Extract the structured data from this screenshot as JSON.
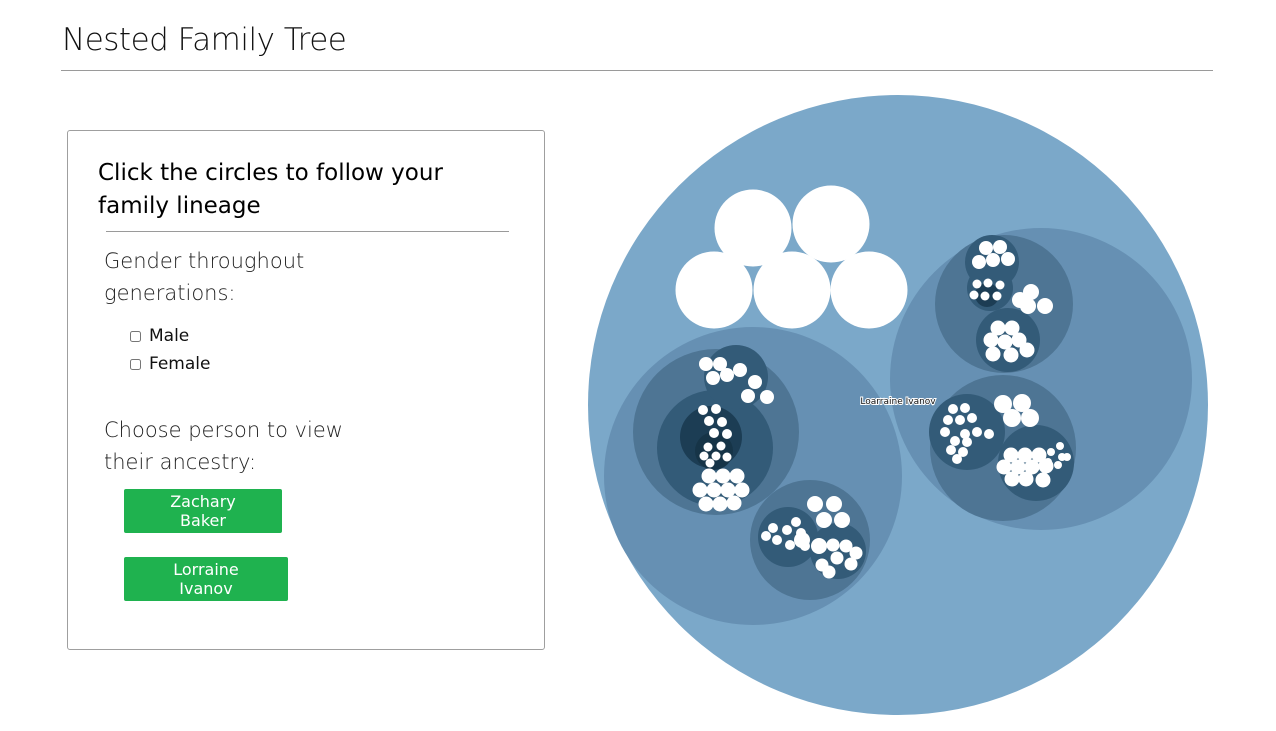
{
  "page": {
    "title": "Nested Family Tree"
  },
  "panel": {
    "heading": "Click the circles to follow your family lineage",
    "gender_label": "Gender throughout generations:",
    "gender_options": [
      {
        "label": "Male",
        "checked": false
      },
      {
        "label": "Female",
        "checked": false
      }
    ],
    "person_label": "Choose person to view their ancestry:",
    "persons": [
      "Zachary Baker",
      "Lorraine Ivanov"
    ]
  },
  "diagram": {
    "center_label": "Loarraine Ivanov",
    "colors": {
      "root": "#7ba8c9",
      "depth1": "#6690b3",
      "depth2": "#4e7594",
      "depth3": "#335b78",
      "depth4": "#1c3d54",
      "leaf": "#ffffff",
      "button": "#1fb24f"
    }
  }
}
